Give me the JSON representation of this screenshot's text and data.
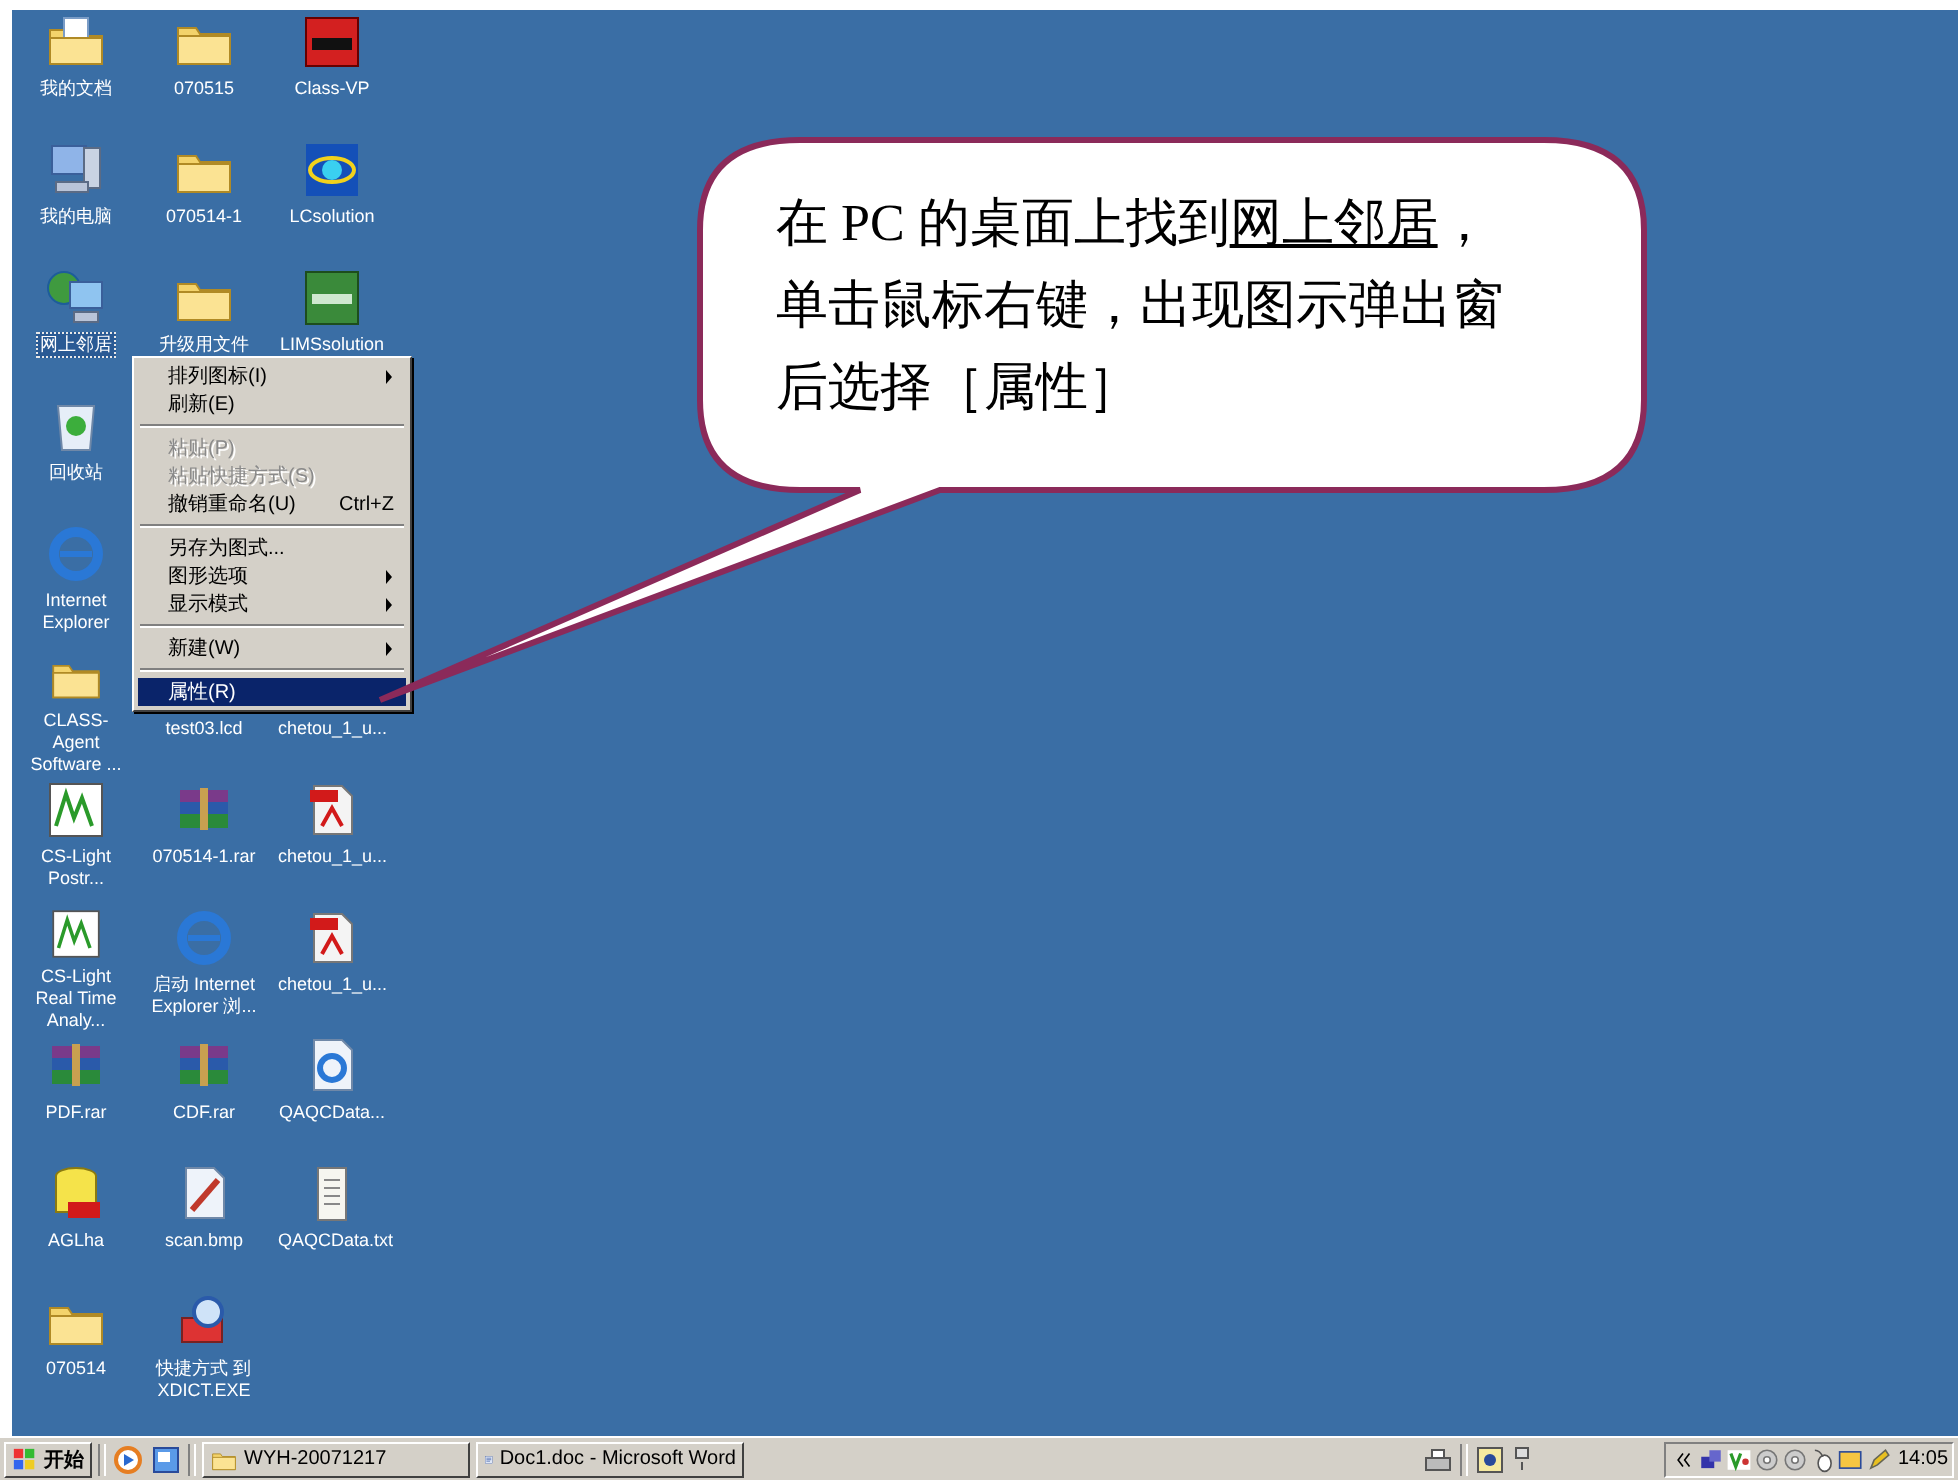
{
  "desktop": {
    "rows": [
      [
        {
          "label": "我的文档",
          "kind": "my-documents",
          "selected": false
        },
        {
          "label": "070515",
          "kind": "folder",
          "selected": false
        },
        {
          "label": "Class-VP",
          "kind": "vp-app",
          "selected": false
        }
      ],
      [
        {
          "label": "我的电脑",
          "kind": "computer",
          "selected": false
        },
        {
          "label": "070514-1",
          "kind": "folder",
          "selected": false
        },
        {
          "label": "LCsolution",
          "kind": "lc-app",
          "selected": false
        }
      ],
      [
        {
          "label": "网上邻居",
          "kind": "network",
          "selected": true
        },
        {
          "label": "升级用文件",
          "kind": "folder",
          "selected": false
        },
        {
          "label": "LIMSsolution",
          "kind": "lims-app",
          "selected": false
        }
      ],
      [
        {
          "label": "回收站",
          "kind": "recycle-bin",
          "selected": false
        }
      ],
      [
        {
          "label": "Internet Explorer",
          "kind": "browser",
          "selected": false
        }
      ],
      [
        {
          "label": "CLASS-Agent Software ...",
          "kind": "folder",
          "selected": false
        },
        {
          "label": "test03.lcd",
          "kind": "blank",
          "selected": false
        },
        {
          "label": "chetou_1_u...",
          "kind": "blank",
          "selected": false
        }
      ],
      [
        {
          "label": "CS-Light Postr...",
          "kind": "chart-app",
          "selected": false
        },
        {
          "label": "070514-1.rar",
          "kind": "archive",
          "selected": false
        },
        {
          "label": "chetou_1_u...",
          "kind": "pdf",
          "selected": false
        }
      ],
      [
        {
          "label": "CS-Light Real Time Analy...",
          "kind": "chart-app",
          "selected": false
        },
        {
          "label": "启动 Internet Explorer 浏...",
          "kind": "browser",
          "selected": false
        },
        {
          "label": "chetou_1_u...",
          "kind": "pdf",
          "selected": false
        }
      ],
      [
        {
          "label": "PDF.rar",
          "kind": "archive",
          "selected": false
        },
        {
          "label": "CDF.rar",
          "kind": "archive",
          "selected": false
        },
        {
          "label": "QAQCData...",
          "kind": "web-file",
          "selected": false
        }
      ],
      [
        {
          "label": "AGLha",
          "kind": "database",
          "selected": false
        },
        {
          "label": "scan.bmp",
          "kind": "image-file",
          "selected": false
        },
        {
          "label": "QAQCData.txt",
          "kind": "text-file",
          "selected": false
        }
      ],
      [
        {
          "label": "070514",
          "kind": "folder",
          "selected": false
        },
        {
          "label": "快捷方式 到 XDICT.EXE",
          "kind": "dictionary-app",
          "selected": false
        }
      ]
    ]
  },
  "context_menu": {
    "items": [
      {
        "kind": "item",
        "label": "排列图标(I)",
        "submenu": true,
        "disabled": false,
        "selected": false
      },
      {
        "kind": "item",
        "label": "刷新(E)",
        "submenu": false,
        "disabled": false,
        "selected": false
      },
      {
        "kind": "separator"
      },
      {
        "kind": "item",
        "label": "粘贴(P)",
        "submenu": false,
        "disabled": true,
        "selected": false
      },
      {
        "kind": "item",
        "label": "粘贴快捷方式(S)",
        "submenu": false,
        "disabled": true,
        "selected": false
      },
      {
        "kind": "item",
        "label": "撤销重命名(U)",
        "shortcut": "Ctrl+Z",
        "submenu": false,
        "disabled": false,
        "selected": false
      },
      {
        "kind": "separator"
      },
      {
        "kind": "item",
        "label": "另存为图式...",
        "submenu": false,
        "disabled": false,
        "selected": false
      },
      {
        "kind": "item",
        "label": "图形选项",
        "submenu": true,
        "disabled": false,
        "selected": false
      },
      {
        "kind": "item",
        "label": "显示模式",
        "submenu": true,
        "disabled": false,
        "selected": false
      },
      {
        "kind": "separator"
      },
      {
        "kind": "item",
        "label": "新建(W)",
        "submenu": true,
        "disabled": false,
        "selected": false
      },
      {
        "kind": "separator"
      },
      {
        "kind": "item",
        "label": "属性(R)",
        "submenu": false,
        "disabled": false,
        "selected": true
      }
    ]
  },
  "callout": {
    "lines": [
      [
        {
          "text": "在 PC 的桌面上找到",
          "underline": false
        },
        {
          "text": "网上邻居",
          "underline": true
        },
        {
          "text": "，",
          "underline": false
        }
      ],
      [
        {
          "text": "单击鼠标右键，出现图示弹出窗",
          "underline": false
        }
      ],
      [
        {
          "text": "后选择［属性］",
          "underline": false
        }
      ]
    ]
  },
  "taskbar": {
    "start": "开始",
    "tasks": [
      {
        "label": "WYH-20071217",
        "kind": "folder",
        "selected": false
      },
      {
        "label": "Doc1.doc - Microsoft Word",
        "kind": "word",
        "selected": false
      }
    ],
    "clock": "14:05"
  }
}
